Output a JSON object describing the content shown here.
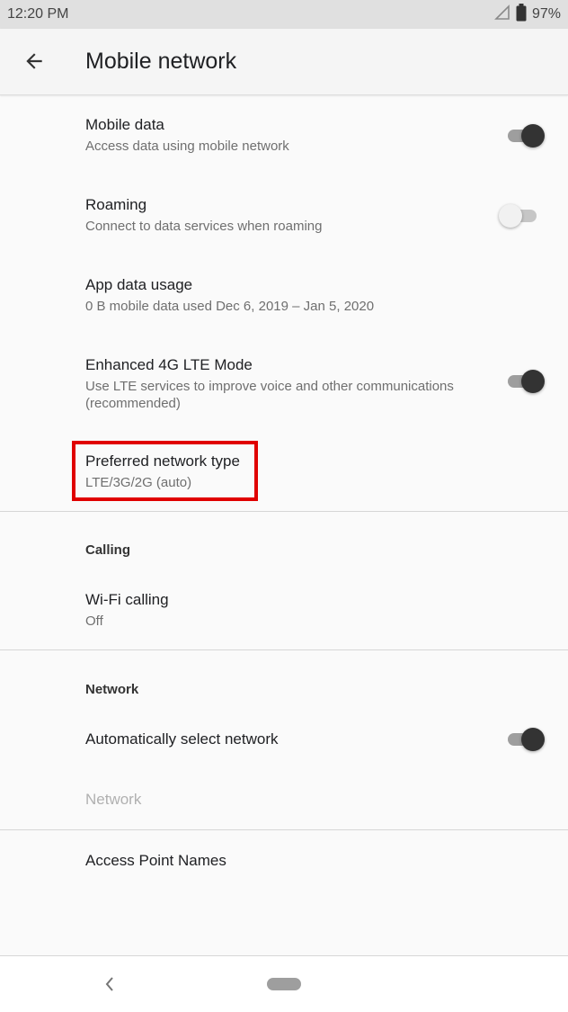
{
  "status_bar": {
    "time": "12:20 PM",
    "battery": "97%"
  },
  "app_bar": {
    "title": "Mobile network"
  },
  "settings": {
    "mobile_data": {
      "title": "Mobile data",
      "summary": "Access data using mobile network",
      "enabled": true
    },
    "roaming": {
      "title": "Roaming",
      "summary": "Connect to data services when roaming",
      "enabled": false
    },
    "app_data_usage": {
      "title": "App data usage",
      "summary": "0 B mobile data used Dec 6, 2019 – Jan 5, 2020"
    },
    "lte_mode": {
      "title": "Enhanced 4G LTE Mode",
      "summary": "Use LTE services to improve voice and other communications (recommended)",
      "enabled": true
    },
    "preferred_network": {
      "title": "Preferred network type",
      "summary": "LTE/3G/2G (auto)"
    }
  },
  "calling": {
    "header": "Calling",
    "wifi_calling": {
      "title": "Wi-Fi calling",
      "summary": "Off"
    }
  },
  "network": {
    "header": "Network",
    "auto_select": {
      "title": "Automatically select network",
      "enabled": true
    },
    "network_item": {
      "title": "Network"
    },
    "apn": {
      "title": "Access Point Names"
    }
  },
  "icons": {
    "back": "arrow-back-icon",
    "signal": "signal-icon",
    "battery": "battery-icon"
  }
}
